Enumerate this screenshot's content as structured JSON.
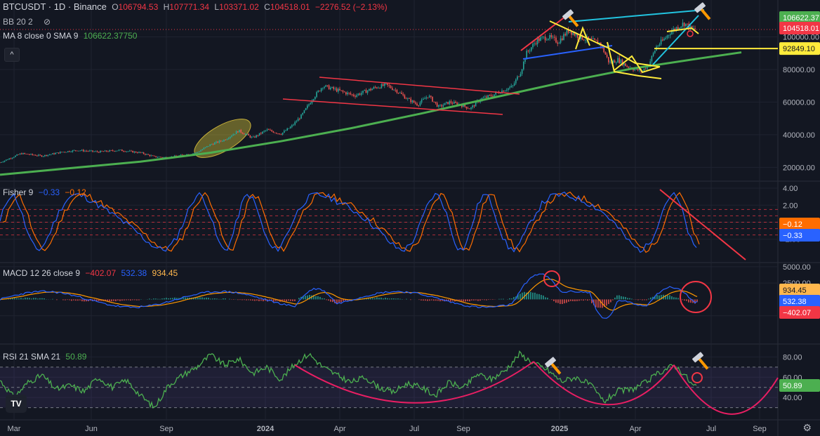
{
  "legend": {
    "symbol": "BTCUSDT · 1D · Binance",
    "o_label": "O",
    "o": "106794.53",
    "h_label": "H",
    "h": "107771.34",
    "l_label": "L",
    "l": "103371.02",
    "c_label": "C",
    "c": "104518.01",
    "change": "−2276.52 (−2.13%)",
    "bb": "BB 20 2",
    "ma_label": "MA 8 close 0 SMA 9",
    "ma_value": "106622.37750",
    "fisher_label": "Fisher 9",
    "fisher_v1": "−0.33",
    "fisher_v2": "−0.12",
    "macd_label": "MACD 12 26 close 9",
    "macd_v1": "−402.07",
    "macd_v2": "532.38",
    "macd_v3": "934.45",
    "rsi_label": "RSI 21 SMA 21",
    "rsi_value": "50.89"
  },
  "toolbar": {
    "collapse_label": "^",
    "logo": "TV"
  },
  "colors": {
    "bg": "#131722",
    "grid": "#1f2330",
    "up": "#26a69a",
    "down": "#ef5350",
    "green_curve": "#4caf50",
    "red_line": "#f23645",
    "yellow": "#ffeb3b",
    "blue": "#2962ff",
    "cyan": "#22c4e0",
    "fisher": "#2962ff",
    "fisher_trigger": "#ff6d00",
    "rsi": "#4caf50",
    "orange": "#ff9800"
  },
  "icons": [
    "hammer-icon",
    "gear-icon",
    "eye-off-icon"
  ],
  "chart_data": [
    {
      "type": "candlestick",
      "title": "BTCUSDT · 1D · Binance",
      "x_ticks": [
        "Mar",
        "Jun",
        "Sep",
        "2024",
        "Apr",
        "Jul",
        "Sep",
        "2025",
        "Apr",
        "Jul",
        "Sep"
      ],
      "y_ticks": [
        "20000.00",
        "40000.00",
        "60000.00",
        "80000.00",
        "100000.00"
      ],
      "ylim": [
        15000,
        120000
      ],
      "price_labels": [
        {
          "value": "106622.37",
          "color": "#4caf50"
        },
        {
          "value": "104518.01",
          "color": "#f23645"
        },
        {
          "value": "92849.10",
          "color": "#ffeb3b"
        }
      ],
      "price_path": [
        [
          0,
          23000
        ],
        [
          30,
          28500
        ],
        [
          60,
          27000
        ],
        [
          90,
          29500
        ],
        [
          110,
          30500
        ],
        [
          140,
          29500
        ],
        [
          170,
          30500
        ],
        [
          200,
          29000
        ],
        [
          220,
          26500
        ],
        [
          240,
          26000
        ],
        [
          260,
          27500
        ],
        [
          280,
          29000
        ],
        [
          300,
          34000
        ],
        [
          320,
          37000
        ],
        [
          340,
          42500
        ],
        [
          360,
          38000
        ],
        [
          380,
          43000
        ],
        [
          400,
          40500
        ],
        [
          415,
          45000
        ],
        [
          430,
          52000
        ],
        [
          445,
          62000
        ],
        [
          460,
          70000
        ],
        [
          475,
          68000
        ],
        [
          490,
          66000
        ],
        [
          505,
          64000
        ],
        [
          520,
          66500
        ],
        [
          535,
          69000
        ],
        [
          550,
          70500
        ],
        [
          565,
          67000
        ],
        [
          580,
          62000
        ],
        [
          595,
          58500
        ],
        [
          610,
          64000
        ],
        [
          625,
          57000
        ],
        [
          640,
          60000
        ],
        [
          655,
          58500
        ],
        [
          670,
          56000
        ],
        [
          685,
          62000
        ],
        [
          700,
          64000
        ],
        [
          715,
          67000
        ],
        [
          730,
          69500
        ],
        [
          742,
          79000
        ],
        [
          750,
          90000
        ],
        [
          765,
          98000
        ],
        [
          780,
          100000
        ],
        [
          795,
          97000
        ],
        [
          810,
          104000
        ],
        [
          825,
          100000
        ],
        [
          840,
          98000
        ],
        [
          855,
          96000
        ],
        [
          868,
          84000
        ],
        [
          880,
          86000
        ],
        [
          893,
          82000
        ],
        [
          905,
          80000
        ],
        [
          915,
          79000
        ],
        [
          925,
          84000
        ],
        [
          935,
          94000
        ],
        [
          945,
          98000
        ],
        [
          955,
          103000
        ],
        [
          965,
          106000
        ],
        [
          975,
          108500
        ],
        [
          985,
          104500
        ],
        [
          992,
          104518
        ]
      ],
      "ma_curve": [
        [
          0,
          15500
        ],
        [
          100,
          19500
        ],
        [
          200,
          23500
        ],
        [
          300,
          29000
        ],
        [
          400,
          36000
        ],
        [
          500,
          44000
        ],
        [
          600,
          53000
        ],
        [
          700,
          62500
        ],
        [
          800,
          72000
        ],
        [
          900,
          80500
        ],
        [
          1000,
          87000
        ],
        [
          1056,
          90500
        ]
      ],
      "level_92849": 92849.1
    },
    {
      "type": "line",
      "title": "Fisher 9",
      "series": [
        {
          "name": "Fisher",
          "last": -0.33
        },
        {
          "name": "Trigger",
          "last": -0.12
        }
      ],
      "y_ticks": [
        "4.00",
        "2.00",
        "0.00",
        "-2.00"
      ],
      "ylim": [
        -4.5,
        4.5
      ],
      "levels": [
        1.5,
        0.75,
        0,
        -0.75,
        -1.5
      ]
    },
    {
      "type": "bar",
      "title": "MACD 12 26 close 9",
      "series": [
        {
          "name": "Histogram",
          "last": -402.07
        },
        {
          "name": "MACD",
          "last": 532.38
        },
        {
          "name": "Signal",
          "last": 934.45
        }
      ],
      "y_ticks": [
        "5000.00",
        "2500.00",
        "-2500.00"
      ],
      "ylim": [
        -6500,
        5200
      ]
    },
    {
      "type": "line",
      "title": "RSI 21 SMA 21",
      "series": [
        {
          "name": "RSI",
          "last": 50.89
        }
      ],
      "y_ticks": [
        "80.00",
        "60.00",
        "40.00"
      ],
      "ylim": [
        20,
        90
      ],
      "levels": [
        70,
        50,
        30
      ],
      "rsi_path": [
        [
          0,
          57
        ],
        [
          20,
          40
        ],
        [
          40,
          55
        ],
        [
          60,
          62
        ],
        [
          80,
          48
        ],
        [
          100,
          52
        ],
        [
          120,
          46
        ],
        [
          140,
          60
        ],
        [
          160,
          50
        ],
        [
          180,
          57
        ],
        [
          200,
          42
        ],
        [
          220,
          30
        ],
        [
          240,
          52
        ],
        [
          260,
          62
        ],
        [
          280,
          70
        ],
        [
          300,
          82
        ],
        [
          320,
          72
        ],
        [
          340,
          78
        ],
        [
          360,
          64
        ],
        [
          380,
          70
        ],
        [
          400,
          58
        ],
        [
          420,
          73
        ],
        [
          440,
          83
        ],
        [
          460,
          70
        ],
        [
          480,
          62
        ],
        [
          500,
          55
        ],
        [
          520,
          60
        ],
        [
          540,
          50
        ],
        [
          560,
          45
        ],
        [
          580,
          54
        ],
        [
          600,
          50
        ],
        [
          620,
          42
        ],
        [
          640,
          55
        ],
        [
          660,
          49
        ],
        [
          680,
          63
        ],
        [
          700,
          58
        ],
        [
          720,
          67
        ],
        [
          740,
          83
        ],
        [
          760,
          74
        ],
        [
          780,
          67
        ],
        [
          800,
          56
        ],
        [
          820,
          60
        ],
        [
          840,
          53
        ],
        [
          860,
          36
        ],
        [
          880,
          46
        ],
        [
          900,
          48
        ],
        [
          920,
          55
        ],
        [
          940,
          65
        ],
        [
          960,
          72
        ],
        [
          975,
          63
        ],
        [
          985,
          53
        ],
        [
          992,
          50.89
        ]
      ]
    }
  ]
}
